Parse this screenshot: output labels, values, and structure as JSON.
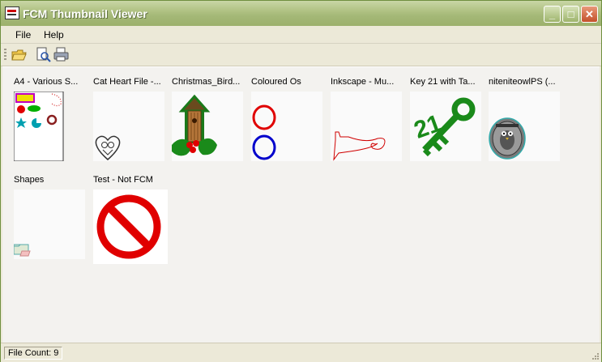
{
  "window": {
    "title": "FCM Thumbnail Viewer"
  },
  "title_buttons": {
    "minimize": "_",
    "maximize": "□",
    "close": "✕"
  },
  "menu": [
    "File",
    "Help"
  ],
  "toolbar": {
    "icons": [
      "open-folder-icon",
      "print-preview-icon",
      "print-icon"
    ]
  },
  "thumbnails": [
    {
      "name": "A4 - Various S..."
    },
    {
      "name": "Cat Heart File -..."
    },
    {
      "name": "Christmas_Bird..."
    },
    {
      "name": "Coloured Os"
    },
    {
      "name": "Inkscape - Mu..."
    },
    {
      "name": "Key 21 with Ta..."
    },
    {
      "name": "niteniteowlPS (..."
    },
    {
      "name": "Shapes"
    },
    {
      "name": "Test - Not FCM"
    }
  ],
  "key_number": "21",
  "status": {
    "file_count": "File Count: 9"
  },
  "colors": {
    "title_bar": "#a4b877",
    "close_button": "#c4502b",
    "red": "#e00000",
    "blue": "#0000cc",
    "green": "#1a8a1a"
  }
}
